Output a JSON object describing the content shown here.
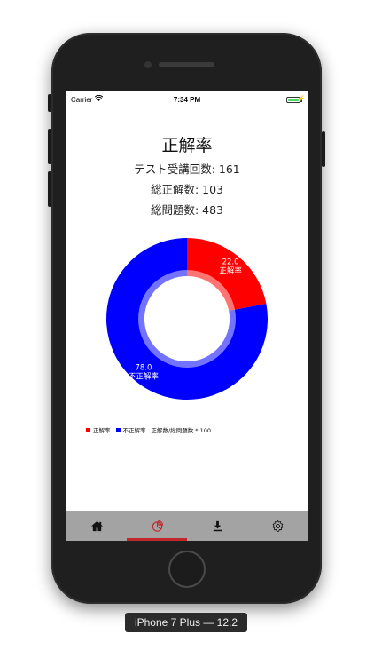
{
  "status_bar": {
    "carrier": "Carrier",
    "time": "7:34 PM",
    "wifi_icon": "wifi-icon",
    "battery_icon": "battery-icon"
  },
  "screen": {
    "title": "正解率",
    "stats": {
      "tests_taken": "テスト受講回数:  161",
      "total_correct": "総正解数:  103",
      "total_questions": "総問題数:  483"
    }
  },
  "chart_data": {
    "type": "pie",
    "donut": true,
    "slices": [
      {
        "value": 22.0,
        "value_label": "22.0",
        "label": "正解率",
        "color": "#ff0000"
      },
      {
        "value": 78.0,
        "value_label": "78.0",
        "label": "不正解率",
        "color": "#0000ff"
      }
    ],
    "legend": {
      "entries": [
        "正解率",
        "不正解率"
      ],
      "description": "正解数/総問題数 * 100"
    }
  },
  "tab_bar": {
    "tabs": [
      {
        "name": "home",
        "icon": "home-icon",
        "active": false
      },
      {
        "name": "chart",
        "icon": "pie-chart-icon",
        "active": true
      },
      {
        "name": "download",
        "icon": "download-icon",
        "active": false
      },
      {
        "name": "settings",
        "icon": "gear-icon",
        "active": false
      }
    ],
    "active_color": "#c1272d"
  },
  "device_label": "iPhone 7 Plus — 12.2"
}
